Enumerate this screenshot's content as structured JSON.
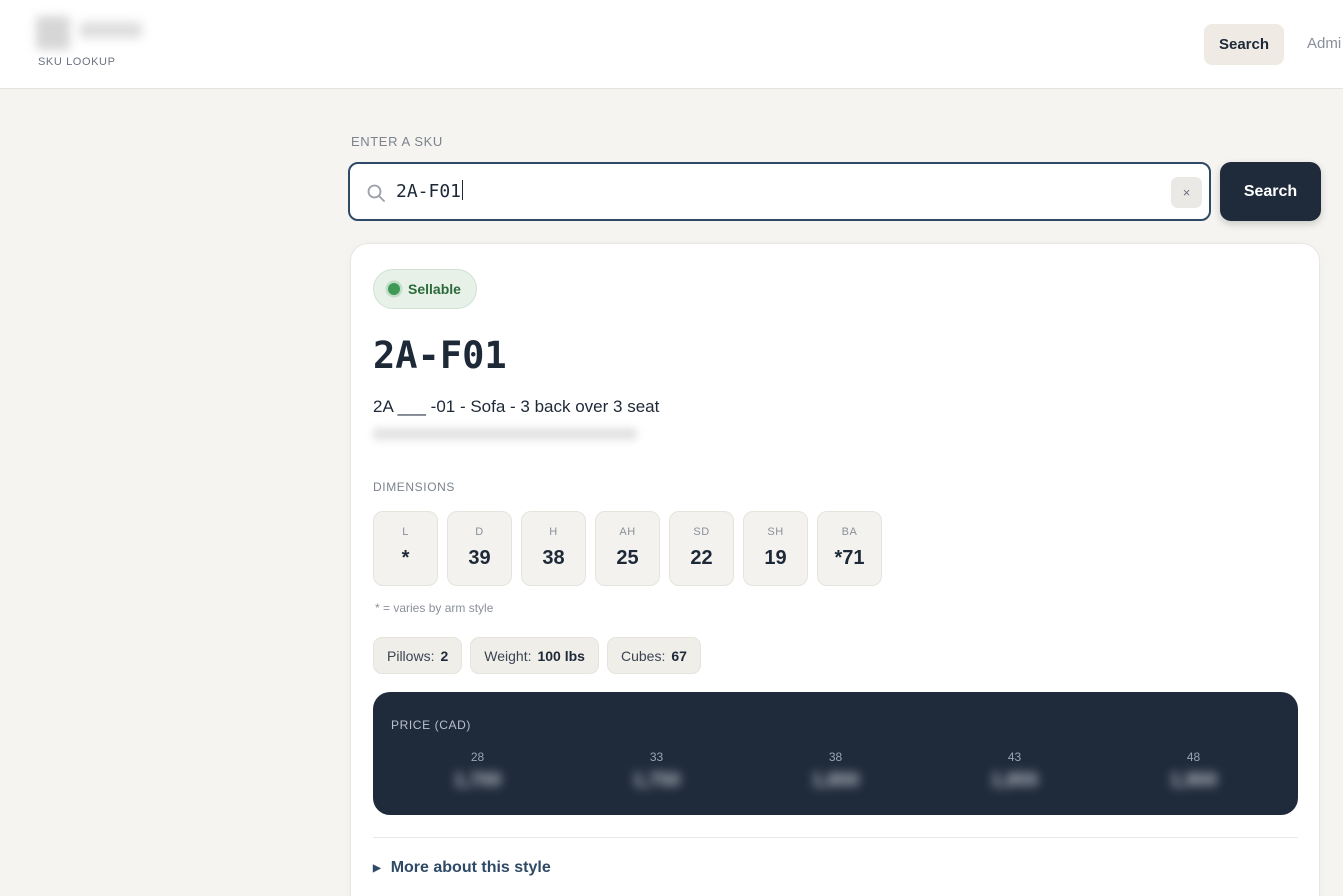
{
  "header": {
    "brand_sub": "SKU LOOKUP",
    "nav": [
      {
        "label": "Search",
        "active": true
      },
      {
        "label": "Admi"
      }
    ]
  },
  "search": {
    "label": "ENTER A SKU",
    "value": "2A-F01",
    "clear_glyph": "×",
    "button_label": "Search",
    "icon": "search-icon"
  },
  "result": {
    "status": "Sellable",
    "status_color": "#3e9a55",
    "sku": "2A-F01",
    "description": "2A ___ -01 - Sofa - 3 back over 3 seat",
    "dimensions_label": "DIMENSIONS",
    "dimensions": [
      {
        "key": "L",
        "value": "*"
      },
      {
        "key": "D",
        "value": "39"
      },
      {
        "key": "H",
        "value": "38"
      },
      {
        "key": "AH",
        "value": "25"
      },
      {
        "key": "SD",
        "value": "22"
      },
      {
        "key": "SH",
        "value": "19"
      },
      {
        "key": "BA",
        "value": "*71"
      }
    ],
    "dimensions_note": "* = varies by arm style",
    "specs": [
      {
        "label": "Pillows:",
        "value": "2"
      },
      {
        "label": "Weight:",
        "value": "100 lbs"
      },
      {
        "label": "Cubes:",
        "value": "67"
      }
    ],
    "price": {
      "label": "PRICE (CAD)",
      "columns": [
        {
          "key": "28",
          "value": "1,700"
        },
        {
          "key": "33",
          "value": "1,750"
        },
        {
          "key": "38",
          "value": "1,800"
        },
        {
          "key": "43",
          "value": "1,855"
        },
        {
          "key": "48",
          "value": "1,900"
        }
      ]
    },
    "more_label": "More about this style",
    "more_glyph": "▶"
  },
  "colors": {
    "accent_dark": "#1f2a3a",
    "page_bg": "#f5f4f1",
    "focus_border": "#2f4a66"
  }
}
